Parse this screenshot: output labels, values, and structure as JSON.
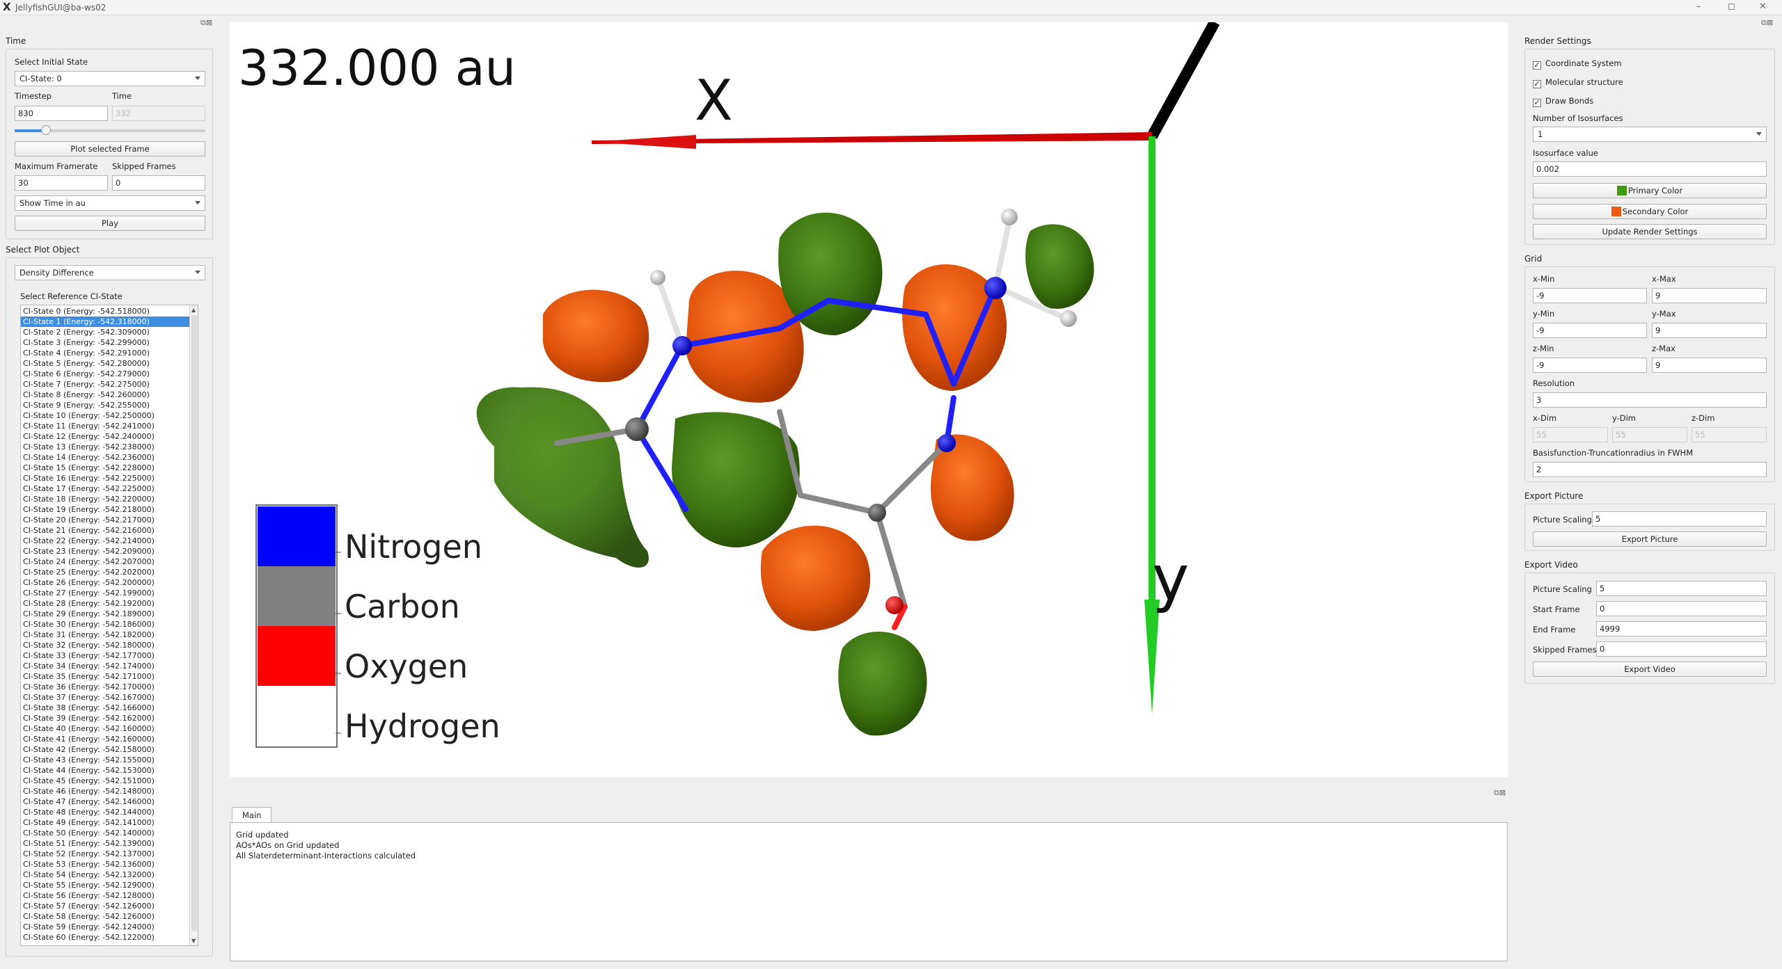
{
  "window": {
    "title": "JellyfishGUI@ba-ws02"
  },
  "left_panel": {
    "time_section": "Time",
    "select_initial_state_label": "Select Initial State",
    "initial_state_value": "CI-State: 0",
    "timestep_label": "Timestep",
    "time_label": "Time",
    "timestep_value": "830",
    "time_value": "332",
    "timestep_slider_fraction": 0.166,
    "plot_frame_button": "Plot selected Frame",
    "max_framerate_label": "Maximum Framerate",
    "skipped_frames_label": "Skipped Frames",
    "max_framerate_value": "30",
    "skipped_frames_value": "0",
    "time_unit_combo": "Show Time in au",
    "play_button": "Play",
    "select_plot_object_section": "Select Plot Object",
    "plot_object_value": "Density Difference",
    "select_reference_label": "Select Reference CI-State",
    "ci_states": [
      "CI-State 0 (Energy: -542.518000)",
      "CI-State 1 (Energy: -542.318000)",
      "CI-State 2 (Energy: -542.309000)",
      "CI-State 3 (Energy: -542.299000)",
      "CI-State 4 (Energy: -542.291000)",
      "CI-State 5 (Energy: -542.280000)",
      "CI-State 6 (Energy: -542.279000)",
      "CI-State 7 (Energy: -542.275000)",
      "CI-State 8 (Energy: -542.260000)",
      "CI-State 9 (Energy: -542.255000)",
      "CI-State 10 (Energy: -542.250000)",
      "CI-State 11 (Energy: -542.241000)",
      "CI-State 12 (Energy: -542.240000)",
      "CI-State 13 (Energy: -542.238000)",
      "CI-State 14 (Energy: -542.236000)",
      "CI-State 15 (Energy: -542.228000)",
      "CI-State 16 (Energy: -542.225000)",
      "CI-State 17 (Energy: -542.225000)",
      "CI-State 18 (Energy: -542.220000)",
      "CI-State 19 (Energy: -542.218000)",
      "CI-State 20 (Energy: -542.217000)",
      "CI-State 21 (Energy: -542.216000)",
      "CI-State 22 (Energy: -542.214000)",
      "CI-State 23 (Energy: -542.209000)",
      "CI-State 24 (Energy: -542.207000)",
      "CI-State 25 (Energy: -542.202000)",
      "CI-State 26 (Energy: -542.200000)",
      "CI-State 27 (Energy: -542.199000)",
      "CI-State 28 (Energy: -542.192000)",
      "CI-State 29 (Energy: -542.189000)",
      "CI-State 30 (Energy: -542.186000)",
      "CI-State 31 (Energy: -542.182000)",
      "CI-State 32 (Energy: -542.180000)",
      "CI-State 33 (Energy: -542.177000)",
      "CI-State 34 (Energy: -542.174000)",
      "CI-State 35 (Energy: -542.171000)",
      "CI-State 36 (Energy: -542.170000)",
      "CI-State 37 (Energy: -542.167000)",
      "CI-State 38 (Energy: -542.166000)",
      "CI-State 39 (Energy: -542.162000)",
      "CI-State 40 (Energy: -542.160000)",
      "CI-State 41 (Energy: -542.160000)",
      "CI-State 42 (Energy: -542.158000)",
      "CI-State 43 (Energy: -542.155000)",
      "CI-State 44 (Energy: -542.153000)",
      "CI-State 45 (Energy: -542.151000)",
      "CI-State 46 (Energy: -542.148000)",
      "CI-State 47 (Energy: -542.146000)",
      "CI-State 48 (Energy: -542.144000)",
      "CI-State 49 (Energy: -542.141000)",
      "CI-State 50 (Energy: -542.140000)",
      "CI-State 51 (Energy: -542.139000)",
      "CI-State 52 (Energy: -542.137000)",
      "CI-State 53 (Energy: -542.136000)",
      "CI-State 54 (Energy: -542.132000)",
      "CI-State 55 (Energy: -542.129000)",
      "CI-State 56 (Energy: -542.128000)",
      "CI-State 57 (Energy: -542.126000)",
      "CI-State 58 (Energy: -542.126000)",
      "CI-State 59 (Energy: -542.124000)",
      "CI-State 60 (Energy: -542.122000)"
    ],
    "selected_state_index": 1
  },
  "viewport": {
    "time_display": "332.000 au",
    "axis_x_label": "X",
    "axis_y_label": "y",
    "legend": [
      {
        "name": "Nitrogen",
        "color": "#0000ff"
      },
      {
        "name": "Carbon",
        "color": "#808080"
      },
      {
        "name": "Oxygen",
        "color": "#ff0000"
      },
      {
        "name": "Hydrogen",
        "color": "#ffffff"
      }
    ],
    "isosurface_primary_color": "#3f7a0f",
    "isosurface_secondary_color": "#e0520a"
  },
  "log": {
    "tab": "Main",
    "lines": [
      "Grid updated",
      "AOs*AOs on Grid updated",
      "All Slaterdeterminant-Interactions calculated"
    ]
  },
  "right_panel": {
    "render_settings_section": "Render Settings",
    "coord_system": {
      "label": "Coordinate System",
      "checked": true
    },
    "molecular_structure": {
      "label": "Molecular structure",
      "checked": true
    },
    "draw_bonds": {
      "label": "Draw Bonds",
      "checked": true
    },
    "num_isosurfaces_label": "Number of Isosurfaces",
    "num_isosurfaces_value": "1",
    "isosurface_value_label": "Isosurface value",
    "isosurface_value": "0.002",
    "primary_color_button": "Primary Color",
    "secondary_color_button": "Secondary Color",
    "update_render_button": "Update Render Settings",
    "grid_section": "Grid",
    "x_min_label": "x-Min",
    "x_min": "-9",
    "x_max_label": "x-Max",
    "x_max": "9",
    "y_min_label": "y-Min",
    "y_min": "-9",
    "y_max_label": "y-Max",
    "y_max": "9",
    "z_min_label": "z-Min",
    "z_min": "-9",
    "z_max_label": "z-Max",
    "z_max": "9",
    "resolution_label": "Resolution",
    "resolution": "3",
    "x_dim_label": "x-Dim",
    "x_dim": "55",
    "y_dim_label": "y-Dim",
    "y_dim": "55",
    "z_dim_label": "z-Dim",
    "z_dim": "55",
    "trunc_label": "Basisfunction-Truncationradius in FWHM",
    "trunc_value": "2",
    "export_picture_section": "Export Picture",
    "pic_scaling_label": "Picture Scaling",
    "pic_scaling_value": "5",
    "export_picture_button": "Export Picture",
    "export_video_section": "Export Video",
    "vid_scaling_label": "Picture Scaling",
    "vid_scaling_value": "5",
    "start_frame_label": "Start Frame",
    "start_frame_value": "0",
    "end_frame_label": "End Frame",
    "end_frame_value": "4999",
    "vid_skipped_label": "Skipped Frames",
    "vid_skipped_value": "0",
    "export_video_button": "Export Video"
  }
}
